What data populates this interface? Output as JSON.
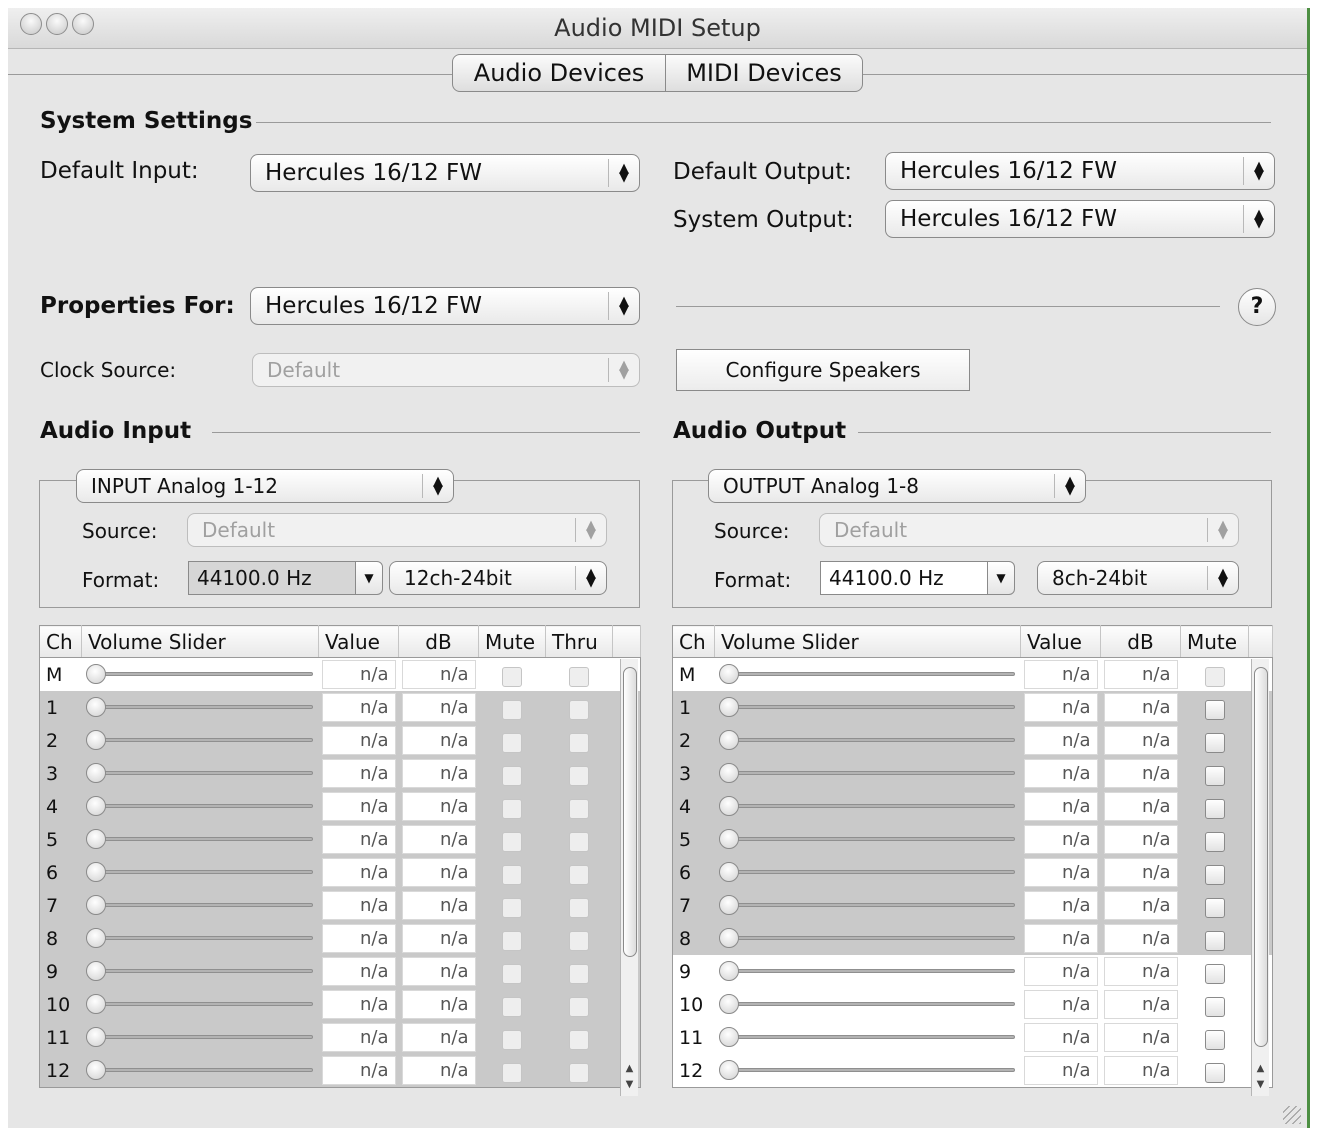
{
  "window": {
    "title": "Audio MIDI Setup"
  },
  "tabs": [
    "Audio Devices",
    "MIDI Devices"
  ],
  "system_settings": {
    "heading": "System Settings",
    "default_input_label": "Default Input:",
    "default_input_value": "Hercules 16/12 FW",
    "default_output_label": "Default Output:",
    "default_output_value": "Hercules 16/12 FW",
    "system_output_label": "System Output:",
    "system_output_value": "Hercules 16/12 FW"
  },
  "properties": {
    "label": "Properties For:",
    "value": "Hercules 16/12 FW",
    "help": "?",
    "clock_source_label": "Clock Source:",
    "clock_source_value": "Default",
    "configure_speakers": "Configure Speakers"
  },
  "audio_input": {
    "heading": "Audio Input",
    "stream": "INPUT Analog 1-12",
    "source_label": "Source:",
    "source_value": "Default",
    "format_label": "Format:",
    "rate": "44100.0 Hz",
    "bits": "12ch-24bit",
    "columns": [
      "Ch",
      "Volume Slider",
      "Value",
      "dB",
      "Mute",
      "Thru"
    ],
    "rows": [
      {
        "ch": "M",
        "value": "n/a",
        "db": "n/a"
      },
      {
        "ch": "1",
        "value": "n/a",
        "db": "n/a"
      },
      {
        "ch": "2",
        "value": "n/a",
        "db": "n/a"
      },
      {
        "ch": "3",
        "value": "n/a",
        "db": "n/a"
      },
      {
        "ch": "4",
        "value": "n/a",
        "db": "n/a"
      },
      {
        "ch": "5",
        "value": "n/a",
        "db": "n/a"
      },
      {
        "ch": "6",
        "value": "n/a",
        "db": "n/a"
      },
      {
        "ch": "7",
        "value": "n/a",
        "db": "n/a"
      },
      {
        "ch": "8",
        "value": "n/a",
        "db": "n/a"
      },
      {
        "ch": "9",
        "value": "n/a",
        "db": "n/a"
      },
      {
        "ch": "10",
        "value": "n/a",
        "db": "n/a"
      },
      {
        "ch": "11",
        "value": "n/a",
        "db": "n/a"
      },
      {
        "ch": "12",
        "value": "n/a",
        "db": "n/a"
      }
    ]
  },
  "audio_output": {
    "heading": "Audio Output",
    "stream": "OUTPUT Analog 1-8",
    "source_label": "Source:",
    "source_value": "Default",
    "format_label": "Format:",
    "rate": "44100.0 Hz",
    "bits": "8ch-24bit",
    "columns": [
      "Ch",
      "Volume Slider",
      "Value",
      "dB",
      "Mute"
    ],
    "rows": [
      {
        "ch": "M",
        "value": "n/a",
        "db": "n/a"
      },
      {
        "ch": "1",
        "value": "n/a",
        "db": "n/a"
      },
      {
        "ch": "2",
        "value": "n/a",
        "db": "n/a"
      },
      {
        "ch": "3",
        "value": "n/a",
        "db": "n/a"
      },
      {
        "ch": "4",
        "value": "n/a",
        "db": "n/a"
      },
      {
        "ch": "5",
        "value": "n/a",
        "db": "n/a"
      },
      {
        "ch": "6",
        "value": "n/a",
        "db": "n/a"
      },
      {
        "ch": "7",
        "value": "n/a",
        "db": "n/a"
      },
      {
        "ch": "8",
        "value": "n/a",
        "db": "n/a"
      },
      {
        "ch": "9",
        "value": "n/a",
        "db": "n/a"
      },
      {
        "ch": "10",
        "value": "n/a",
        "db": "n/a"
      },
      {
        "ch": "11",
        "value": "n/a",
        "db": "n/a"
      },
      {
        "ch": "12",
        "value": "n/a",
        "db": "n/a"
      }
    ]
  }
}
